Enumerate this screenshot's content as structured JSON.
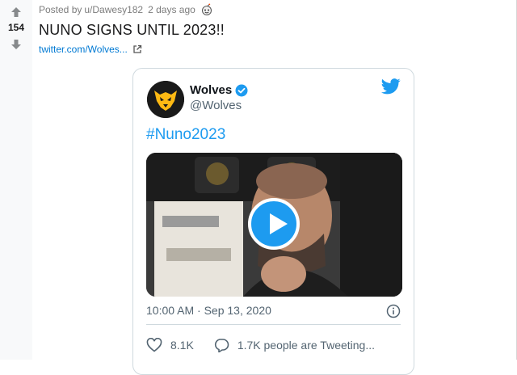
{
  "vote": {
    "count": "154"
  },
  "post": {
    "posted_by_prefix": "Posted by",
    "username": "u/Dawesy182",
    "time": "2 days ago",
    "title": "NUNO SIGNS UNTIL 2023!!",
    "link_text": "twitter.com/Wolves..."
  },
  "tweet": {
    "author_name": "Wolves",
    "author_handle": "@Wolves",
    "hashtag": "#Nuno2023",
    "timestamp": "10:00 AM · Sep 13, 2020",
    "likes": "8.1K",
    "replies": "1.7K people are Tweeting..."
  },
  "colors": {
    "reddit_blue": "#0079d3",
    "twitter_blue": "#1d9bf0",
    "wolves_gold": "#FDB913",
    "text_muted": "#536471"
  },
  "icons": [
    "upvote-icon",
    "downvote-icon",
    "award-icon",
    "external-link-icon",
    "verified-icon",
    "twitter-bird-icon",
    "play-icon",
    "info-icon",
    "heart-icon",
    "comment-icon"
  ]
}
